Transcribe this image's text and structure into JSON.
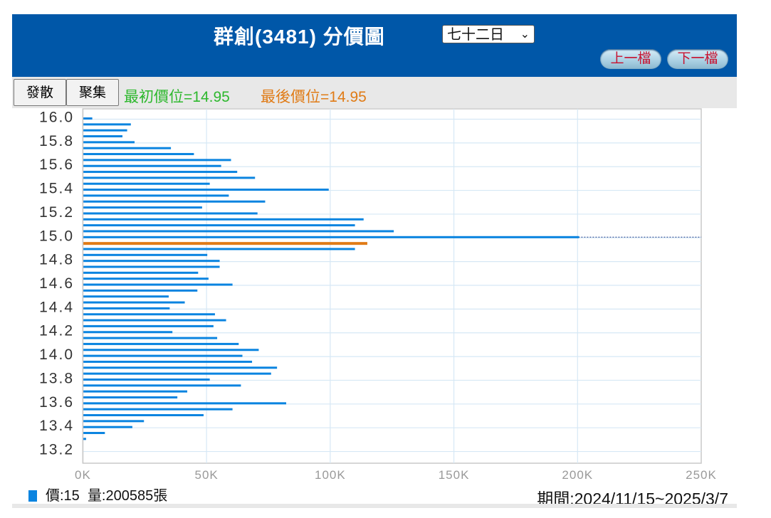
{
  "header": {
    "title": "群創(3481) 分價圖",
    "period_select": "七十二日",
    "prev_button": "上一檔",
    "next_button": "下一檔"
  },
  "toolbar": {
    "spread_button": "發散",
    "gather_button": "聚集",
    "first_price": "最初價位=14.95",
    "last_price": "最後價位=14.95"
  },
  "colors": {
    "bar": "#0a84e0",
    "highlight": "#e07b16",
    "header": "#0057a8"
  },
  "legend": {
    "price": "價:15",
    "volume": "量:200585張"
  },
  "period": "期間:2024/11/15~2025/3/7",
  "chart_data": {
    "type": "bar",
    "orientation": "horizontal",
    "xlabel": "",
    "ylabel": "",
    "xlim": [
      0,
      250
    ],
    "ylim": [
      13.2,
      16.0
    ],
    "x_ticks": [
      "0K",
      "50K",
      "100K",
      "150K",
      "200K",
      "250K"
    ],
    "y_ticks": [
      "16.0",
      "15.8",
      "15.6",
      "15.4",
      "15.2",
      "15.0",
      "14.8",
      "14.6",
      "14.4",
      "14.2",
      "14.0",
      "13.8",
      "13.6",
      "13.4",
      "13.2"
    ],
    "grid": true,
    "highlight_price": 14.95,
    "current_price": 15.0,
    "prices": [
      16.0,
      15.95,
      15.9,
      15.85,
      15.8,
      15.75,
      15.7,
      15.65,
      15.6,
      15.55,
      15.5,
      15.45,
      15.4,
      15.35,
      15.3,
      15.25,
      15.2,
      15.15,
      15.1,
      15.05,
      15.0,
      14.95,
      14.9,
      14.85,
      14.8,
      14.75,
      14.7,
      14.65,
      14.6,
      14.55,
      14.5,
      14.45,
      14.4,
      14.35,
      14.3,
      14.25,
      14.2,
      14.15,
      14.1,
      14.05,
      14.0,
      13.95,
      13.9,
      13.85,
      13.8,
      13.75,
      13.7,
      13.65,
      13.6,
      13.55,
      13.5,
      13.45,
      13.4,
      13.35,
      13.3
    ],
    "volumes_k": [
      3.8,
      19.4,
      17.9,
      16.0,
      20.9,
      35.6,
      44.9,
      59.9,
      55.9,
      62.4,
      69.6,
      51.3,
      99.4,
      59.0,
      73.7,
      48.2,
      70.6,
      113.5,
      110.0,
      125.7,
      200.6,
      115.0,
      110.0,
      50.3,
      55.3,
      55.3,
      46.6,
      50.8,
      60.5,
      46.3,
      34.7,
      41.2,
      35.1,
      53.4,
      57.9,
      52.8,
      36.2,
      54.3,
      63.0,
      71.1,
      64.5,
      68.4,
      78.5,
      76.1,
      51.3,
      63.9,
      42.2,
      38.2,
      82.2,
      60.5,
      48.8,
      24.7,
      20.0,
      8.9,
      1.3
    ]
  }
}
